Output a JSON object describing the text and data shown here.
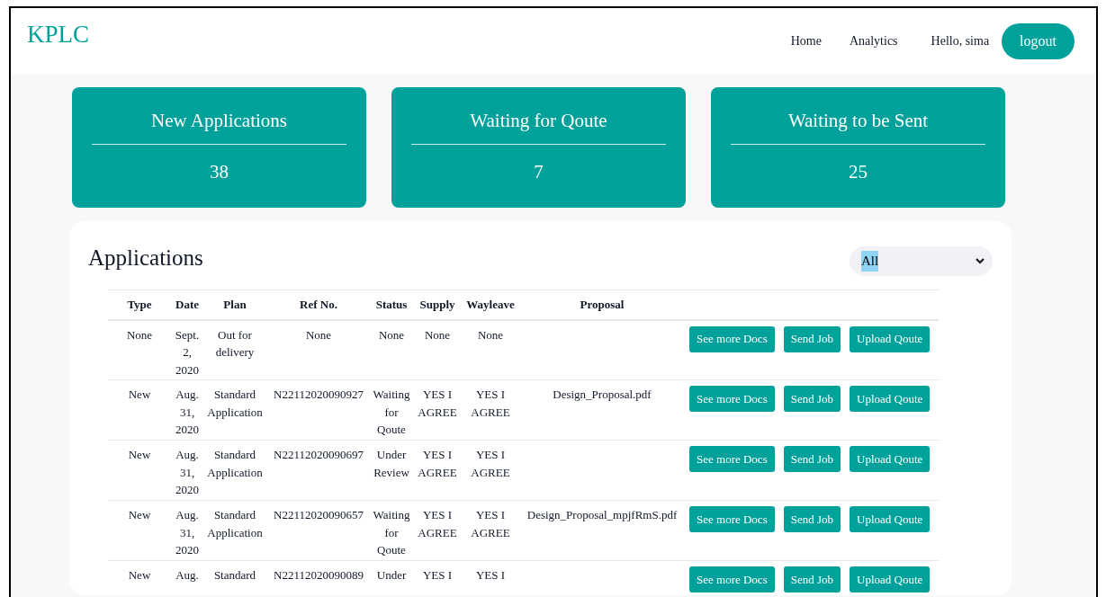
{
  "brand": "KPLC",
  "nav": [
    {
      "label": "Home"
    },
    {
      "label": "Analytics"
    }
  ],
  "greeting": "Hello, sima",
  "logout": "logout",
  "stats": [
    {
      "title": "New Applications",
      "value": "38"
    },
    {
      "title": "Waiting for Qoute",
      "value": "7"
    },
    {
      "title": "Waiting to be Sent",
      "value": "25"
    }
  ],
  "applications": {
    "title": "Applications",
    "filter": {
      "value": "All"
    },
    "columns": [
      "Type",
      "Date",
      "Plan",
      "Ref No.",
      "Status",
      "Supply",
      "Wayleave",
      "Proposal"
    ],
    "rows": [
      {
        "cells": [
          "None",
          "Sept. 2, 2020",
          "Out for delivery",
          "None",
          "None",
          "None",
          "None",
          ""
        ],
        "actions": [
          "See more Docs",
          "Send Job",
          "Upload Qoute"
        ]
      },
      {
        "cells": [
          "New",
          "Aug. 31, 2020",
          "Standard Application",
          "N22112020090927",
          "Waiting for Qoute",
          "YES I AGREE",
          "YES I AGREE",
          "Design_Proposal.pdf"
        ],
        "actions": [
          "See more Docs",
          "Send Job",
          "Upload Qoute"
        ]
      },
      {
        "cells": [
          "New",
          "Aug. 31, 2020",
          "Standard Application",
          "N22112020090697",
          "Under Review",
          "YES I AGREE",
          "YES I AGREE",
          ""
        ],
        "actions": [
          "See more Docs",
          "Send Job",
          "Upload Qoute"
        ]
      },
      {
        "cells": [
          "New",
          "Aug. 31, 2020",
          "Standard Application",
          "N22112020090657",
          "Waiting for Qoute",
          "YES I AGREE",
          "YES I AGREE",
          "Design_Proposal_mpjfRmS.pdf"
        ],
        "actions": [
          "See more Docs",
          "Send Job",
          "Upload Qoute"
        ]
      },
      {
        "cells": [
          "New",
          "Aug.",
          "Standard",
          "N22112020090089",
          "Under",
          "YES I",
          "YES I",
          ""
        ],
        "actions": [
          "See more Docs",
          "Send Job",
          "Upload Qoute"
        ]
      }
    ]
  }
}
